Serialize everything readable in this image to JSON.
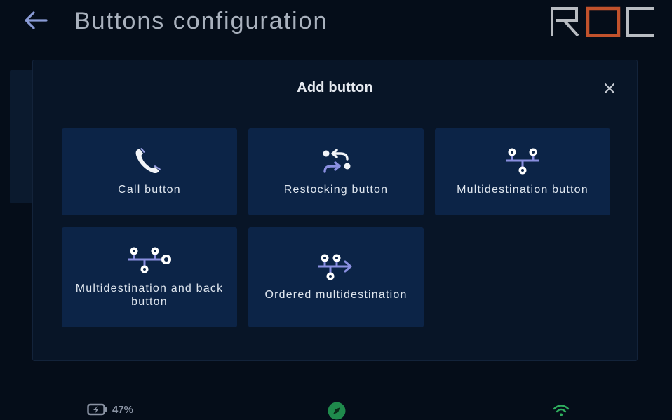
{
  "header": {
    "title": "Buttons configuration",
    "logo_text": "ROC",
    "back_icon": "arrow-left-icon"
  },
  "modal": {
    "title": "Add button",
    "close_icon": "close-icon",
    "options": [
      {
        "label": "Call button",
        "icon": "phone-icon"
      },
      {
        "label": "Restocking button",
        "icon": "restocking-arrows-icon"
      },
      {
        "label": "Multidestination button",
        "icon": "multidestination-icon"
      },
      {
        "label": "Multidestination and back button",
        "icon": "multidestination-back-icon"
      },
      {
        "label": "Ordered multidestination",
        "icon": "ordered-multidestination-icon"
      }
    ]
  },
  "status_bar": {
    "battery_percent": "47%",
    "battery_icon": "battery-charging-icon",
    "nav_icon": "compass-icon",
    "wifi_icon": "wifi-icon"
  },
  "colors": {
    "background": "#050d19",
    "modal": "#081527",
    "tile": "#0c2447",
    "icon_white": "#f2f4f8",
    "icon_purple": "#8a8fe0",
    "logo_gray": "#b8bcc2",
    "logo_orange": "#c2522c",
    "nav_green": "#1f8a4c",
    "wifi_green": "#2fae5e"
  }
}
